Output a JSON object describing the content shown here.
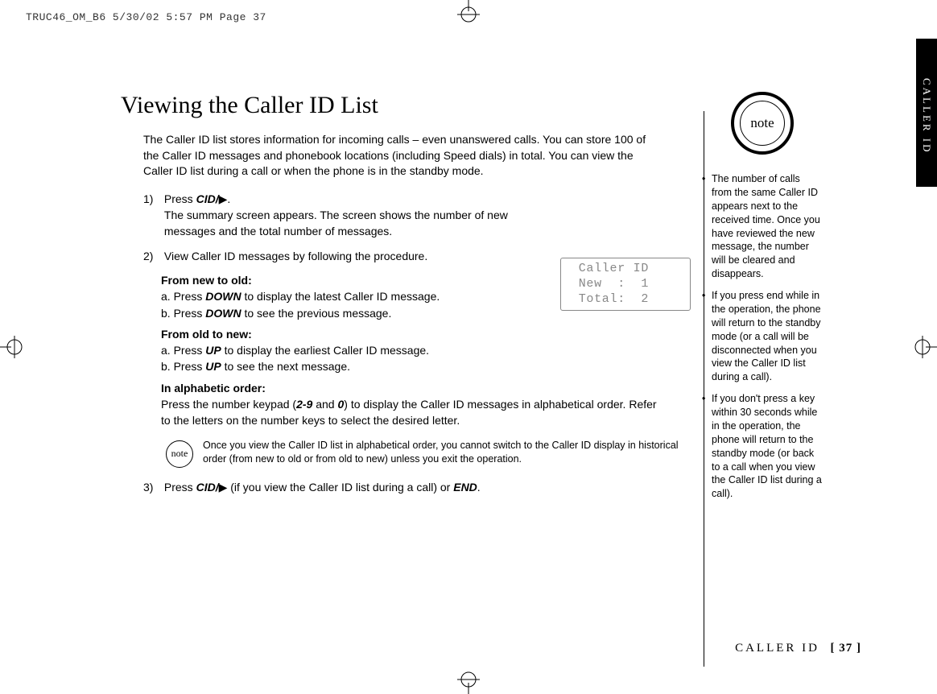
{
  "header_strip": "TRUC46_OM_B6  5/30/02  5:57 PM  Page 37",
  "title": "Viewing the Caller ID List",
  "intro": "The Caller ID list stores information for incoming calls – even unanswered calls. You can store 100 of the Caller ID messages and phonebook locations (including Speed dials) in total. You can view the Caller ID list during a call or when the phone is in the standby mode.",
  "steps": {
    "s1_num": "1)",
    "s1_press": "Press ",
    "s1_cid": "CID/",
    "s1_tri": "▶",
    "s1_dot": ".",
    "s1_rest": "The summary screen appears. The screen shows the number of new messages and the total number of messages.",
    "s2_num": "2)",
    "s2_text": "View Caller ID messages by following the procedure.",
    "fnto_head": "From new to old:",
    "fnto_a_pre": "a. Press ",
    "fnto_a_key": "DOWN",
    "fnto_a_post": " to display the latest Caller ID message.",
    "fnto_b_pre": "b. Press ",
    "fnto_b_key": "DOWN",
    "fnto_b_post": " to see the previous message.",
    "fotn_head": "From old to new:",
    "fotn_a_pre": "a. Press ",
    "fotn_a_key": "UP",
    "fotn_a_post": " to display the earliest Caller ID message.",
    "fotn_b_pre": "b. Press ",
    "fotn_b_key": "UP",
    "fotn_b_post": " to see the next message.",
    "alpha_head": "In alphabetic order:",
    "alpha_pre1": "Press the number keypad (",
    "alpha_k1": "2-9",
    "alpha_mid": " and ",
    "alpha_k2": "0",
    "alpha_post1": ") to display the Caller ID messages in alphabetical order. Refer to the letters on the number keys to select the desired letter.",
    "inline_note": "Once you view the Caller ID list in alphabetical order, you cannot switch to the Caller ID display in historical order (from new to old or from old to new) unless you exit the operation.",
    "s3_num": "3)",
    "s3_pre": "Press ",
    "s3_cid": "CID/",
    "s3_tri": "▶",
    "s3_mid": " (if you view the Caller ID list during a call) or ",
    "s3_end": "END",
    "s3_dot": "."
  },
  "lcd": " Caller ID\n New  :  1\n Total:  2",
  "note_word": "note",
  "side_bullets": [
    "The number of calls from the same Caller ID appears next to the received time. Once you have reviewed the new message, the number will be cleared and disappears.",
    "If you press end while in the operation, the phone will return to the standby mode (or a call will be disconnected when you view the Caller ID list during a call).",
    "If you don't press a key within 30 seconds while in the operation, the phone will return to the standby mode (or back to a call when you view the Caller ID list during a call)."
  ],
  "tab": "CALLER ID",
  "footer_label": "CALLER ID",
  "footer_page": "[ 37 ]"
}
